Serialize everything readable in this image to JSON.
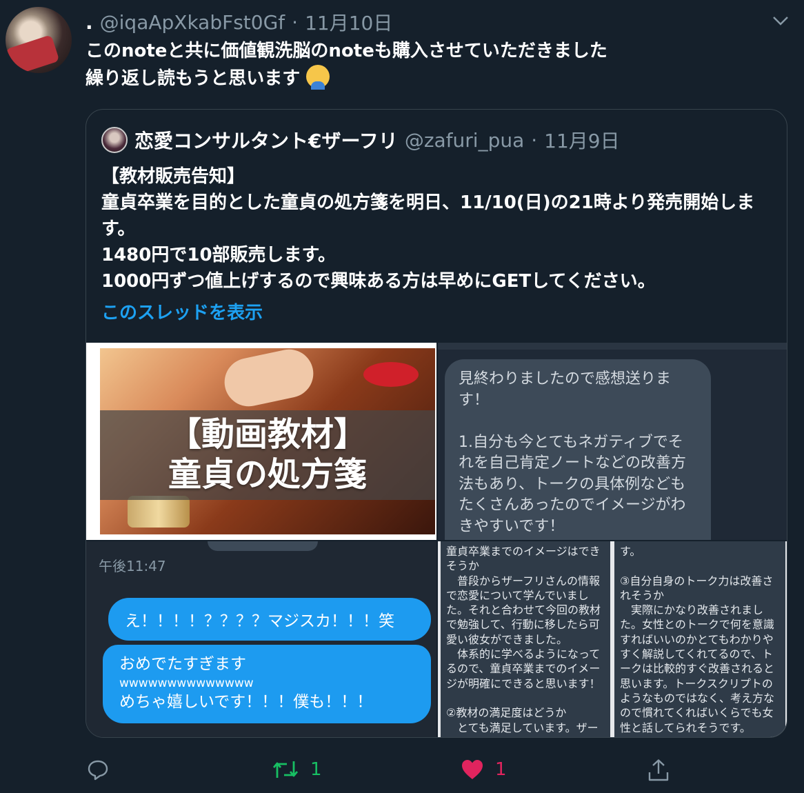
{
  "author": {
    "name": ".",
    "handle": "@iqaApXkabFst0Gf",
    "separator": "·",
    "date": "11月10日"
  },
  "tweet": {
    "line1": "このnoteと共に価値観洗脳のnoteも購入させていただきました",
    "line2": "繰り返し読もうと思います",
    "emoji": "person-bowing-emoji"
  },
  "quote": {
    "name": "恋愛コンサルタント€ザーフリ",
    "handle": "@zafuri_pua",
    "separator": "·",
    "date": "11月9日",
    "lines": [
      "【教材販売告知】",
      "童貞卒業を目的とした童貞の処方箋を明日、11/10(日)の21時より発売開始します。",
      "1480円で10部販売します。",
      "1000円ずつ値上げするので興味ある方は早めにGETしてください。"
    ],
    "thread_link": "このスレッドを表示"
  },
  "media": {
    "banner": "【動画教材】\n童貞の処方箋",
    "review_bubble": "見終わりましたので感想送ります！\n\n1.自分も今とてもネガティブでそれを自己肯定ノートなどの改善方法もあり、トークの具体例などもたくさんあったのでイメージがわきやすいです！",
    "chat_time": "午後11:47",
    "chat_msg1": "え！！！！？？？？マジスカ！！！笑",
    "chat_msg2_a": "おめでたすぎます",
    "chat_msg2_b": "wwwwwwwwwwwwww",
    "chat_msg2_c": "めちゃ嬉しいです！！！僕も！！！",
    "note_left": "童貞卒業までのイメージはできそうか\n　普段からザーフリさんの情報で恋愛について学んでいました。それと合わせて今回の教材で勉強して、行動に移したら可愛い彼女ができました。\n　体系的に学べるようになってるので、童貞卒業までのイメージが明確にできると思います！\n\n②教材の満足度はどうか\n　とても満足しています。ザー",
    "note_right": "す。\n\n③自分自身のトーク力は改善されそうか\n　実際にかなり改善されました。女性とのトークで何を意識すればいいのかとてもわかりやすく解説してくれてるので、トークは比較的すぐ改善されると思います。トークスクリプトのようなものではなく、考え方なので慣れてくればいくらでも女性と話してられそうです。"
  },
  "actions": {
    "reply_icon": "reply-icon",
    "retweet_icon": "retweet-icon",
    "retweet_count": "1",
    "like_icon": "heart-icon",
    "like_count": "1",
    "share_icon": "share-icon",
    "retweet_color": "#17bf63",
    "like_color": "#e0245e"
  },
  "colors": {
    "background": "#15202b",
    "secondary_text": "#8899a6",
    "link": "#1da1f2",
    "border": "#38444d"
  }
}
